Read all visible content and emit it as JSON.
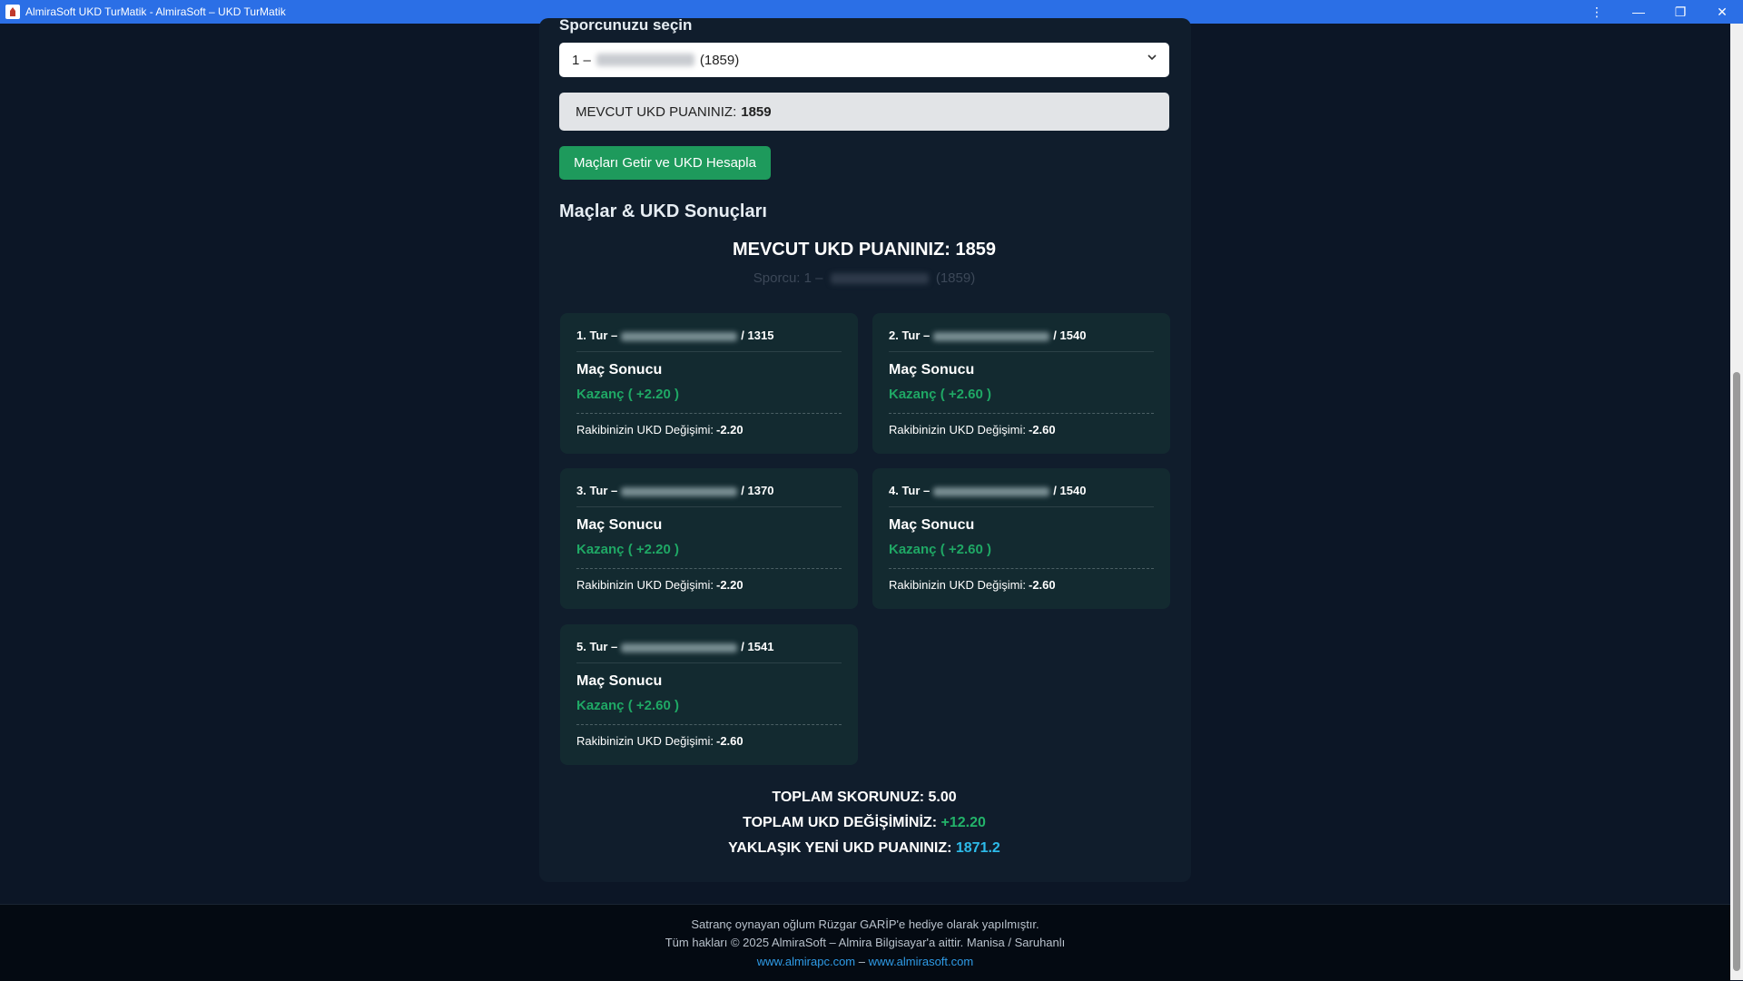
{
  "window": {
    "title": "AlmiraSoft UKD TurMatik - AlmiraSoft – UKD TurMatik",
    "menu_icon": "⋮",
    "minimize_icon": "—",
    "restore_icon": "❐",
    "close_icon": "✕"
  },
  "form": {
    "select_label": "Sporcunuzu seçin",
    "selected_prefix": "1 –",
    "selected_rating": "(1859)",
    "current_prefix": "MEVCUT UKD PUANINIZ:",
    "current_value": "1859",
    "calculate_button": "Maçları Getir ve UKD Hesapla"
  },
  "results": {
    "section_title": "Maçlar & UKD Sonuçları",
    "big_title": "MEVCUT UKD PUANINIZ: 1859",
    "athlete_prefix": "Sporcu: 1 –",
    "athlete_rating": "(1859)",
    "result_label": "Maç Sonucu",
    "opponent_change_label": "Rakibinizin UKD Değişimi:",
    "matches": [
      {
        "round": "1. Tur –",
        "rating": "/ 1315",
        "result": "Kazanç ( +2.20 )",
        "opp_change": "-2.20"
      },
      {
        "round": "2. Tur –",
        "rating": "/ 1540",
        "result": "Kazanç ( +2.60 )",
        "opp_change": "-2.60"
      },
      {
        "round": "3. Tur –",
        "rating": "/ 1370",
        "result": "Kazanç ( +2.20 )",
        "opp_change": "-2.20"
      },
      {
        "round": "4. Tur –",
        "rating": "/ 1540",
        "result": "Kazanç ( +2.60 )",
        "opp_change": "-2.60"
      },
      {
        "round": "5. Tur –",
        "rating": "/ 1541",
        "result": "Kazanç ( +2.60 )",
        "opp_change": "-2.60"
      }
    ]
  },
  "totals": {
    "score_label": "TOPLAM SKORUNUZ: 5.00",
    "change_label": "TOPLAM UKD DEĞİŞİMİNİZ:",
    "change_value": "+12.20",
    "new_label": "YAKLAŞIK YENİ UKD PUANINIZ:",
    "new_value": "1871.2"
  },
  "footer": {
    "line1": "Satranç oynayan oğlum Rüzgar GARİP'e hediye olarak yapılmıştır.",
    "line2": "Tüm hakları © 2025 AlmiraSoft – Almira Bilgisayar'a aittir. Manisa / Saruhanlı",
    "link1": "www.almirapc.com",
    "link_sep": "–",
    "link2": "www.almirasoft.com"
  },
  "colors": {
    "accent_green": "#1e9a5c",
    "win_text": "#1fa865",
    "new_rating": "#2dbbea",
    "titlebar": "#2b6fe6"
  }
}
